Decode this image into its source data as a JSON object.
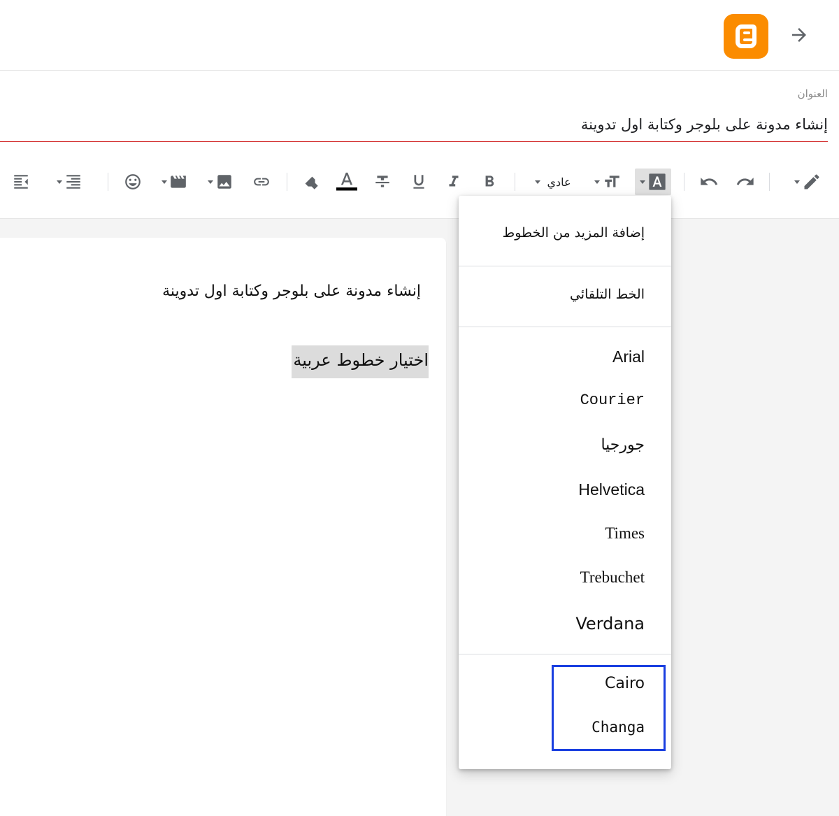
{
  "header": {
    "logo": "blogger-logo",
    "back_icon": "arrow-forward-icon"
  },
  "post": {
    "title_label": "العنوان",
    "title_value": "إنشاء مدونة على بلوجر وكتابة اول تدوينة"
  },
  "toolbar": {
    "paragraph_label": "عادي",
    "icons": [
      "pencil-mode-icon",
      "redo-icon",
      "undo-icon",
      "font-family-icon",
      "font-size-icon",
      "paragraph-style",
      "bold-icon",
      "italic-icon",
      "underline-icon",
      "strikethrough-icon",
      "text-color-icon",
      "highlight-icon",
      "link-icon",
      "image-icon",
      "video-icon",
      "emoji-icon",
      "align-icon",
      "indent-icon"
    ]
  },
  "editor": {
    "heading": "إنشاء مدونة على بلوجر وكتابة اول تدوينة",
    "selected_text": "اختيار خطوط عربية"
  },
  "font_menu": {
    "add_more": "إضافة المزيد من الخطوط",
    "default_font": "الخط التلقائي",
    "fonts": [
      "Arial",
      "Courier",
      "جورجيا",
      "Helvetica",
      "Times",
      "Trebuchet",
      "Verdana"
    ],
    "custom_fonts": [
      "Cairo",
      "Changa"
    ]
  },
  "colors": {
    "accent_red": "#d32f2f",
    "blogger_orange": "#fb8c00",
    "highlight_blue": "#1a3fe0",
    "icon_gray": "#5f6368"
  }
}
